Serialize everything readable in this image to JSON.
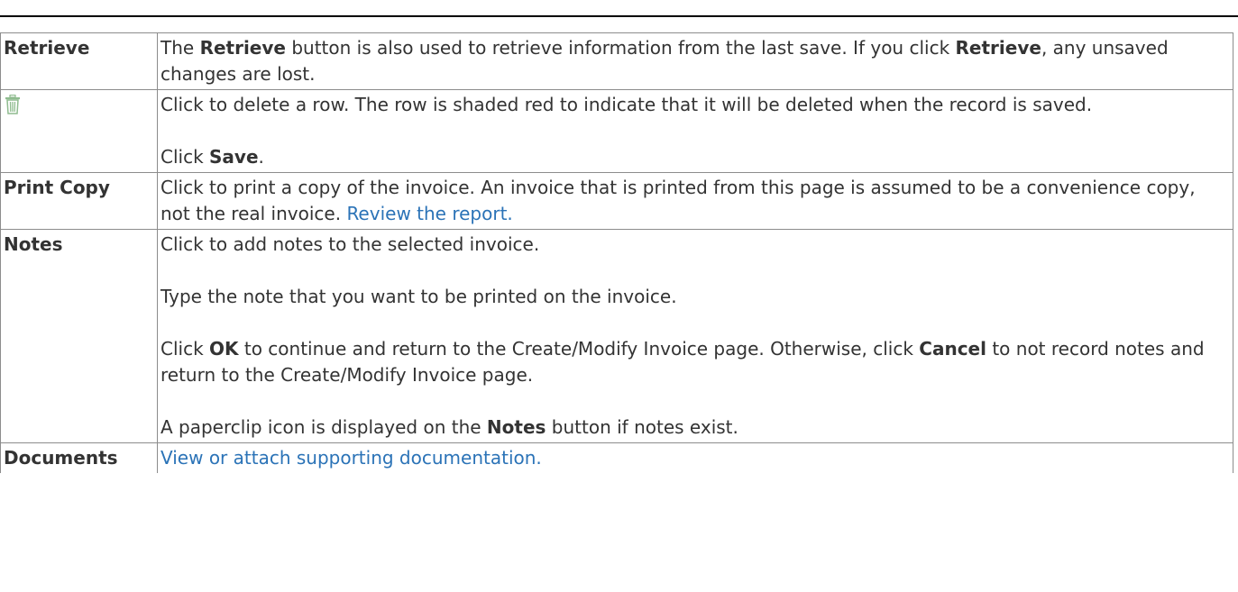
{
  "rows": [
    {
      "label": "Retrieve",
      "desc": [
        {
          "pre": "The ",
          "bold": "Retrieve",
          "post": " button is also used to retrieve information from the last save. If you click "
        },
        {
          "bold": "Retrieve",
          "post": ", any unsaved changes are lost."
        }
      ]
    },
    {
      "label_icon": "trash-icon",
      "para1": "Click to delete a row. The row is shaded red to indicate that it will be deleted when the record is saved.",
      "para2_pre": "Click ",
      "para2_bold": "Save",
      "para2_post": "."
    },
    {
      "label": "Print Copy",
      "text": "Click to print a copy of the invoice. An invoice that is printed from this page is assumed to be a convenience copy, not the real invoice. ",
      "link": "Review the report."
    },
    {
      "label": "Notes",
      "para1": "Click to add notes to the selected invoice.",
      "para2": "Type the note that you want to be printed on the invoice.",
      "para3": {
        "pre": "Click ",
        "bold1": "OK",
        "mid": " to continue and return to the Create/Modify Invoice page. Otherwise, click ",
        "bold2": "Cancel",
        "post": " to not record notes and return to the Create/Modify Invoice page."
      },
      "para4": {
        "pre": "A paperclip icon is displayed on the ",
        "bold": "Notes",
        "post": " button if notes exist."
      }
    },
    {
      "label": "Documents",
      "link": "View or attach supporting documentation."
    }
  ],
  "colors": {
    "link": "#2b73b7",
    "border": "#8c8c8c",
    "text": "#333333",
    "icon": "#8fbc8f"
  }
}
